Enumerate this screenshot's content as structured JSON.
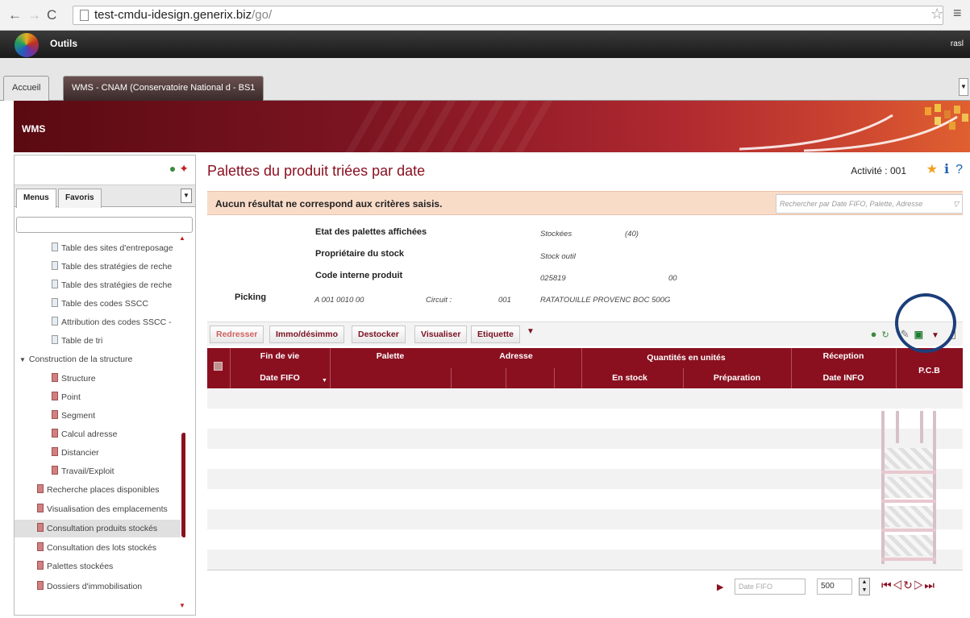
{
  "browser": {
    "url_host": "test-cmdu-idesign.generix.biz",
    "url_path": "/go/"
  },
  "toolbar": {
    "title": "Outils",
    "user": "rasl"
  },
  "tabs": {
    "home": "Accueil",
    "active": "WMS - CNAM (Conservatoire National d - BS1"
  },
  "banner": {
    "title": "WMS"
  },
  "sidebar": {
    "tab_menus": "Menus",
    "tab_favoris": "Favoris",
    "items": [
      {
        "label": "Table des sites d'entreposage"
      },
      {
        "label": "Table des stratégies de reche"
      },
      {
        "label": "Table des stratégies de reche"
      },
      {
        "label": "Table des codes SSCC"
      },
      {
        "label": "Attribution des codes SSCC -"
      },
      {
        "label": "Table de tri"
      },
      {
        "label": "Construction de la structure"
      },
      {
        "label": "Structure"
      },
      {
        "label": "Point"
      },
      {
        "label": "Segment"
      },
      {
        "label": "Calcul adresse"
      },
      {
        "label": "Distancier"
      },
      {
        "label": "Travail/Exploit"
      },
      {
        "label": "Recherche places disponibles"
      },
      {
        "label": "Visualisation des emplacements"
      },
      {
        "label": "Consultation produits stockés"
      },
      {
        "label": "Consultation des lots stockés"
      },
      {
        "label": "Palettes stockées"
      },
      {
        "label": "Dossiers d'immobilisation"
      }
    ]
  },
  "main": {
    "title": "Palettes du produit triées par date",
    "activity": "Activité : 001",
    "message": "Aucun résultat ne correspond aux critères saisis.",
    "search_placeholder": "Rechercher par Date  FIFO, Palette, Adresse",
    "info": {
      "etat_label": "Etat des palettes affichées",
      "etat_value": "Stockées",
      "etat_count": "(40)",
      "proprietaire_label": "Propriétaire du stock",
      "proprietaire_value": "Stock outil",
      "code_label": "Code interne produit",
      "code_value": "025819",
      "code_suffix": "00",
      "picking_label": "Picking",
      "picking_value": "A 001 0010 00",
      "circuit_label": "Circuit :",
      "circuit_value": "001",
      "product_name": "RATATOUILLE PROVENC BOC 500G"
    },
    "actions": {
      "redresser": "Redresser",
      "immo": "Immo/désimmo",
      "destocker": "Destocker",
      "visualiser": "Visualiser",
      "etiquette": "Etiquette"
    },
    "grid": {
      "fin_de_vie": "Fin de vie",
      "date_fifo": "Date  FIFO",
      "palette": "Palette",
      "adresse": "Adresse",
      "quantites": "Quantités en unités",
      "en_stock": "En stock",
      "preparation": "Préparation",
      "reception": "Réception",
      "date_info": "Date  INFO",
      "pcb": "P.C.B"
    },
    "pager": {
      "date_placeholder": "Date  FIFO",
      "page_size": "500"
    }
  }
}
